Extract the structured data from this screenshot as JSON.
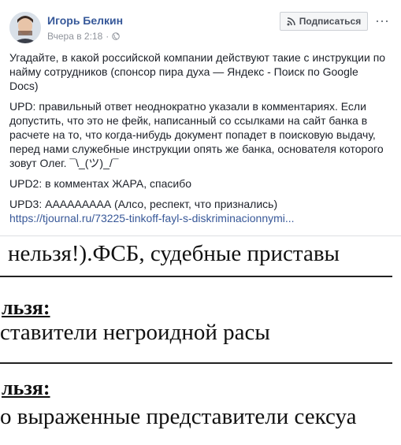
{
  "header": {
    "author": "Игорь Белкин",
    "timestamp": "Вчера в 2:18",
    "subscribe_label": "Подписаться",
    "more_label": "···"
  },
  "post": {
    "p1": "Угадайте, в какой российской компании действуют такие с инструкции по найму сотрудников (спонсор пира духа — Яндекс - Поиск по Google Docs)",
    "p2": "UPD: правильный ответ неоднократно указали в комментариях. Если допустить, что это не фейк, написанный со ссылками на сайт банка в расчете на то, что когда-нибудь документ попадет в поисковую выдачу, перед нами служебные инструкции опять же банка, основателя которого зовут Олег. ¯\\_(ツ)_/¯",
    "p3": "UPD2: в комментах ЖАРА, спасибо",
    "p4": "UPD3: ААААААААА (Алсо, респект, что признались)",
    "link": "https://tjournal.ru/73225-tinkoff-fayl-s-diskriminacionnymi..."
  },
  "scan": {
    "line1": "нельзя!).ФСБ, судебные приставы",
    "label1": "льзя:",
    "line2": "ставители негроидной расы",
    "label2": "льзя:",
    "line3": "о выраженные представители сексуа"
  },
  "colors": {
    "link": "#385898",
    "author": "#365899",
    "scan_red": "#c21818"
  }
}
